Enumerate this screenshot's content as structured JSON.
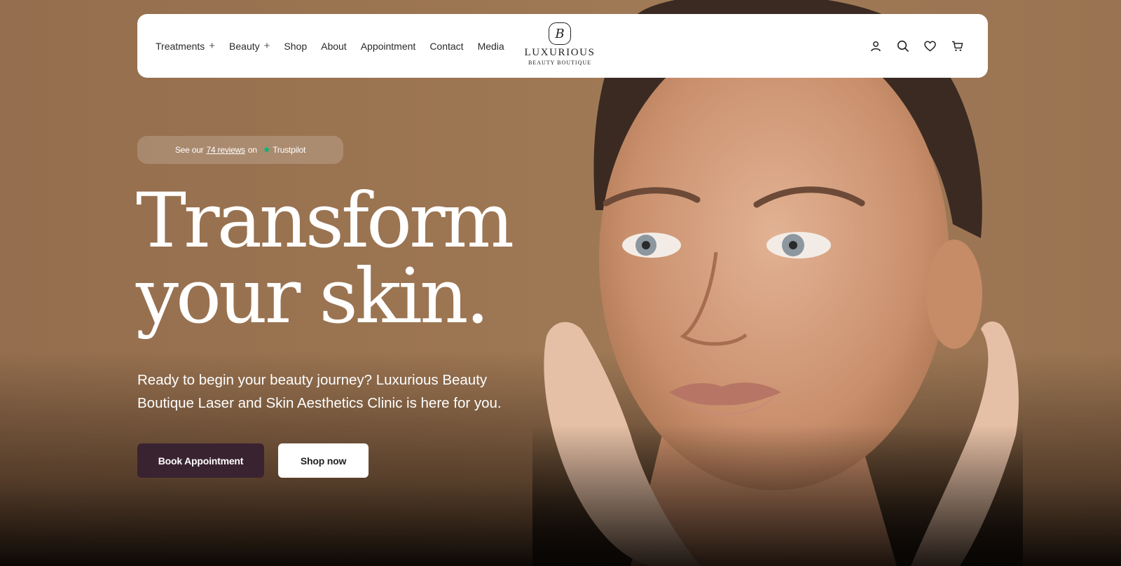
{
  "nav": {
    "items": [
      {
        "label": "Treatments",
        "has_submenu": true
      },
      {
        "label": "Beauty",
        "has_submenu": true
      },
      {
        "label": "Shop",
        "has_submenu": false
      },
      {
        "label": "About",
        "has_submenu": false
      },
      {
        "label": "Appointment",
        "has_submenu": false
      },
      {
        "label": "Contact",
        "has_submenu": false
      },
      {
        "label": "Media",
        "has_submenu": false
      }
    ],
    "submenu_glyph": "+",
    "icons": [
      "user-icon",
      "search-icon",
      "heart-icon",
      "cart-icon"
    ]
  },
  "logo": {
    "monogram": "B",
    "name": "LUXURIOUS",
    "tagline": "BEAUTY BOUTIQUE"
  },
  "trustpilot": {
    "prefix": "See our",
    "link": "74 reviews",
    "suffix": "on",
    "brand": "Trustpilot",
    "star_color": "#00b67a"
  },
  "hero": {
    "headline_line1": "Transform",
    "headline_line2": "your skin.",
    "subtext": "Ready to begin your beauty journey? Luxurious Beauty Boutique Laser and Skin Aesthetics Clinic is here for you.",
    "primary_button": "Book Appointment",
    "secondary_button": "Shop now"
  },
  "colors": {
    "background": "#9a7452",
    "primary_button": "#3a2330",
    "navbar": "#ffffff"
  }
}
